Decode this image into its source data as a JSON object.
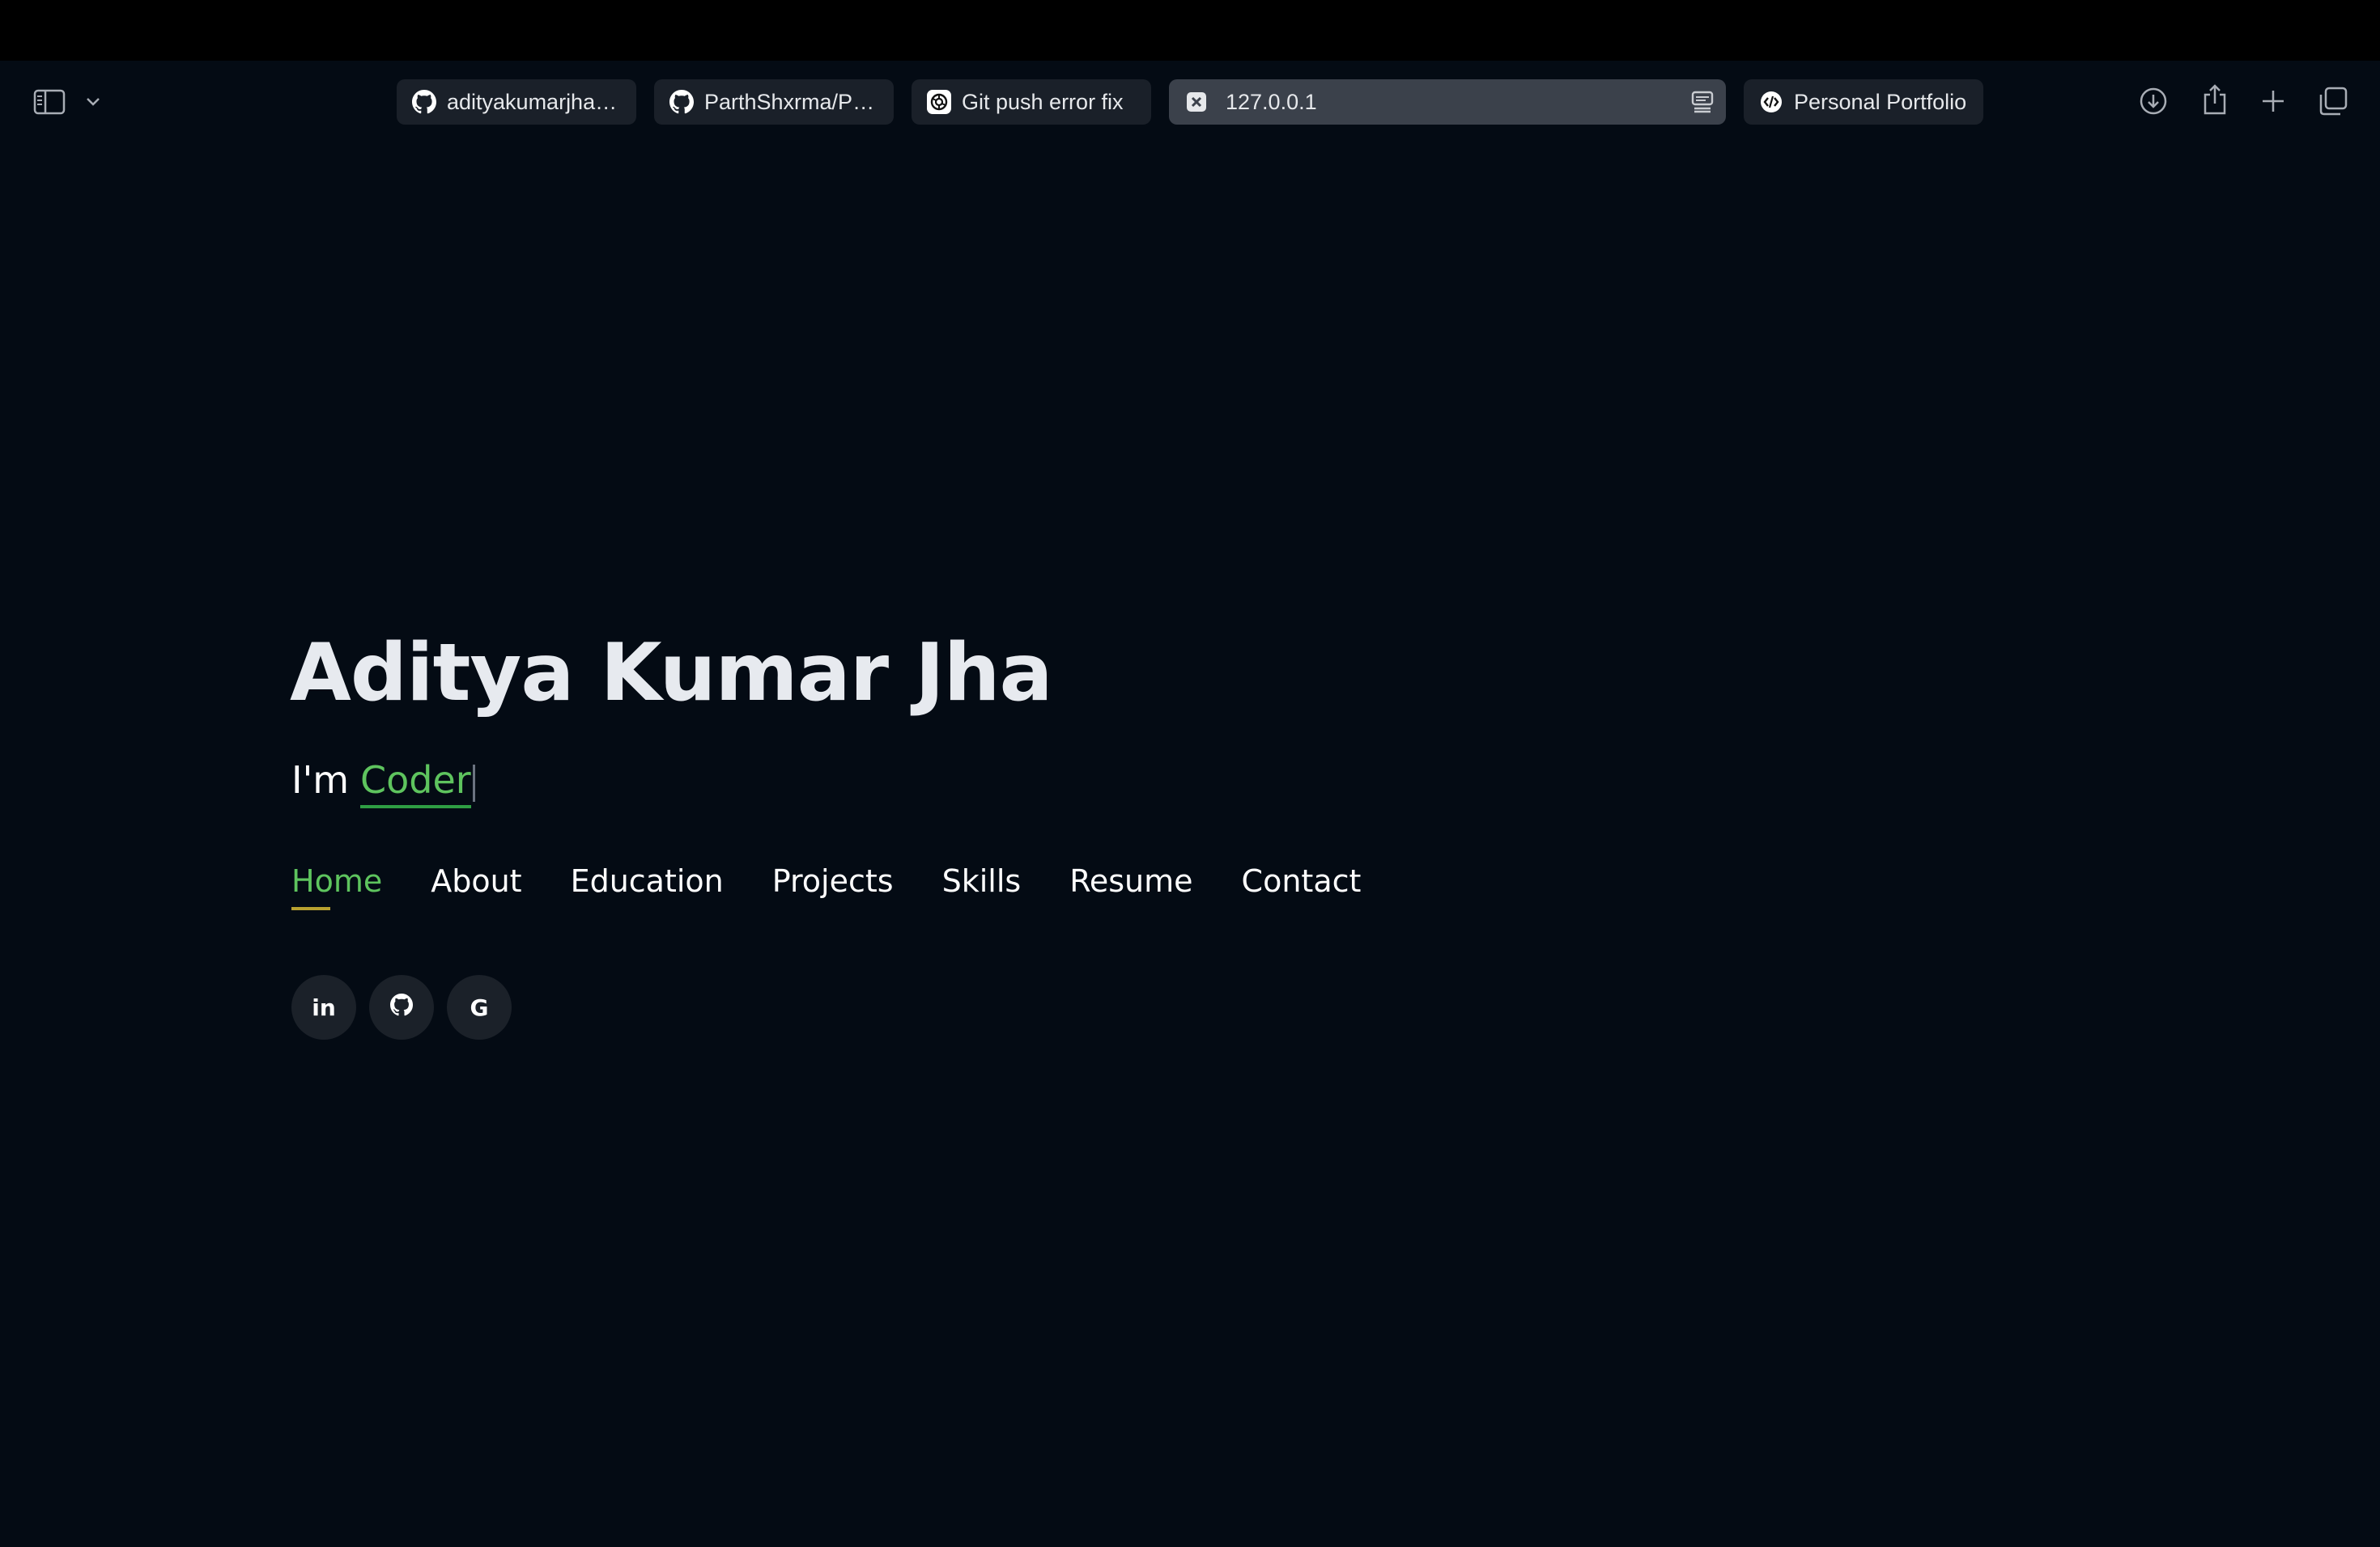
{
  "browser": {
    "tabs": [
      {
        "label": "adityakumarjha1...",
        "favicon": "github-icon"
      },
      {
        "label": "ParthShxrma/Po...",
        "favicon": "github-icon"
      },
      {
        "label": "Git push error fix",
        "favicon": "openai-icon"
      },
      {
        "label": "127.0.0.1",
        "favicon": "close-square-icon",
        "active": true
      },
      {
        "label": "Personal Portfolio",
        "favicon": "code-icon"
      }
    ],
    "toolbar_icons": [
      "sidebar-icon",
      "chevron-down-icon",
      "download-icon",
      "share-icon",
      "plus-icon",
      "tab-overview-icon"
    ]
  },
  "hero": {
    "name": "Aditya Kumar Jha",
    "typed_prefix": "I'm",
    "typed_word": "Coder"
  },
  "nav": {
    "items": [
      "Home",
      "About",
      "Education",
      "Projects",
      "Skills",
      "Resume",
      "Contact"
    ],
    "active": "Home"
  },
  "socials": [
    {
      "label": "in",
      "icon": "linkedin-icon"
    },
    {
      "label": "",
      "icon": "github-icon"
    },
    {
      "label": "G",
      "icon": "google-icon"
    }
  ],
  "colors": {
    "background": "#040b14",
    "accent_green": "#5ec45e",
    "underline_green": "#2f9e44",
    "underline_gold": "#b8a130",
    "tab_bg": "#1a2029",
    "tab_active_bg": "#3b414b"
  }
}
